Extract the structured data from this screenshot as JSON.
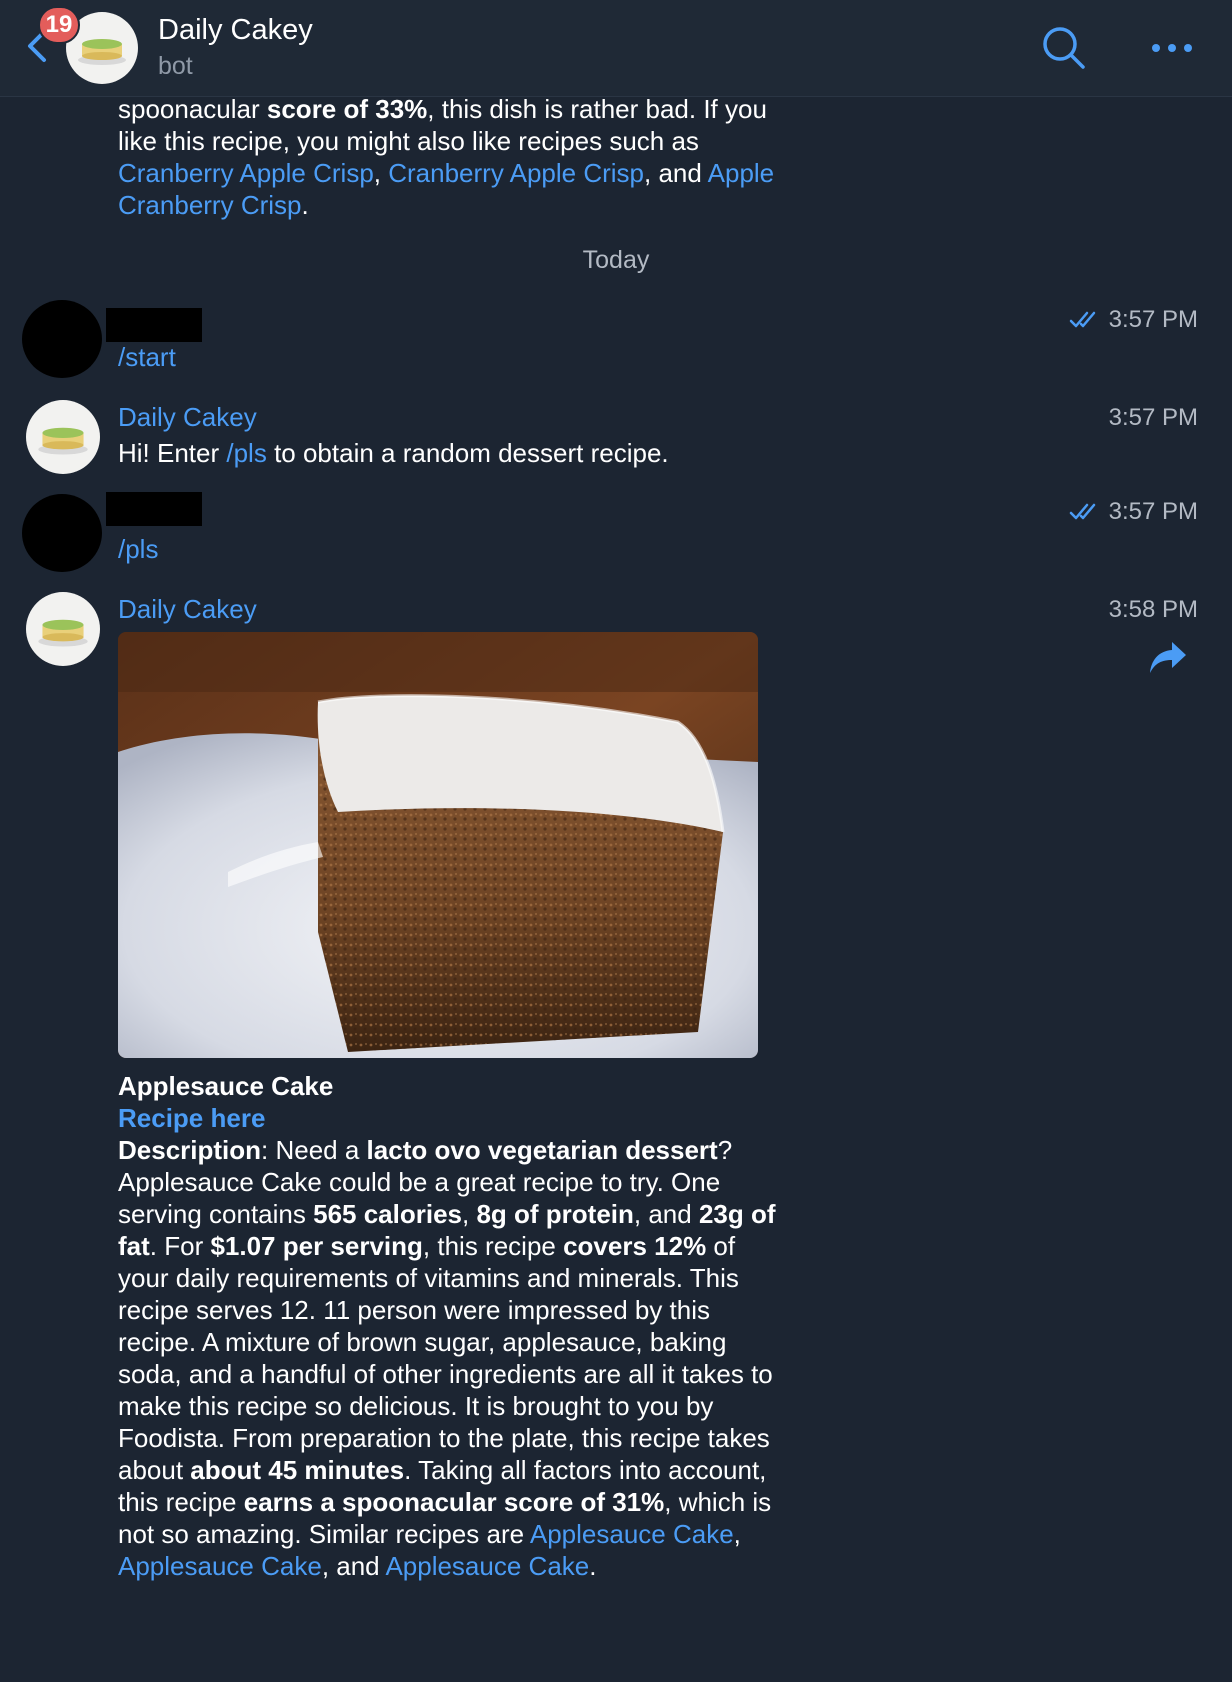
{
  "header": {
    "badge_count": "19",
    "title": "Daily Cakey",
    "subtitle": "bot",
    "icons": [
      "chevron-left-icon",
      "search-icon",
      "more-dots-icon"
    ]
  },
  "previous_message": {
    "t1": "spoonacular ",
    "b1": "score of 33%",
    "t2": ", this dish is rather bad. If you like this recipe, you might also like recipes such as ",
    "l1": "Cranberry Apple Crisp",
    "t3": ", ",
    "l2": "Cranberry Apple Crisp",
    "t4": ", and ",
    "l3": "Apple Cranberry Crisp",
    "t5": "."
  },
  "date_separator": "Today",
  "messages": [
    {
      "time": "3:57 PM",
      "command": "/start"
    },
    {
      "sender": "Daily Cakey",
      "time": "3:57 PM",
      "t1": "Hi! Enter ",
      "l1": "/pls",
      "t2": " to obtain a random dessert recipe."
    },
    {
      "time": "3:57 PM",
      "command": "/pls"
    },
    {
      "sender": "Daily Cakey",
      "time": "3:58 PM"
    }
  ],
  "recipe": {
    "title": "Applesauce Cake",
    "link": "Recipe here",
    "d_label": "Description",
    "t1": ": Need a ",
    "b1": "lacto ovo vegetarian dessert",
    "t2": "? Applesauce Cake could be a great recipe to try. One serving contains ",
    "b2": "565 calories",
    "t3": ", ",
    "b3": "8g of protein",
    "t4": ", and ",
    "b4": "23g of fat",
    "t5": ". For ",
    "b5": "$1.07 per serving",
    "t6": ", this recipe ",
    "b6": "covers 12%",
    "t7": " of your daily requirements of vitamins and minerals. This recipe serves 12. 11 person were impressed by this recipe. A mixture of brown sugar, applesauce, baking soda, and a handful of other ingredients are all it takes to make this recipe so delicious. It is brought to you by Foodista. From preparation to the plate, this recipe takes about ",
    "b7": "about 45 minutes",
    "t8": ". Taking all factors into account, this recipe ",
    "b8": "earns a spoonacular score of 31%",
    "t9": ", which is not so amazing. Similar recipes are ",
    "l1": "Applesauce Cake",
    "t10": ", ",
    "l2": "Applesauce Cake",
    "t11": ", and ",
    "l3": "Applesauce Cake",
    "t12": "."
  },
  "colors": {
    "background": "#1c2532",
    "header": "#1f2936",
    "accent": "#4b9cf5",
    "badge": "#e35d5b",
    "muted_text": "#b3bac4"
  }
}
